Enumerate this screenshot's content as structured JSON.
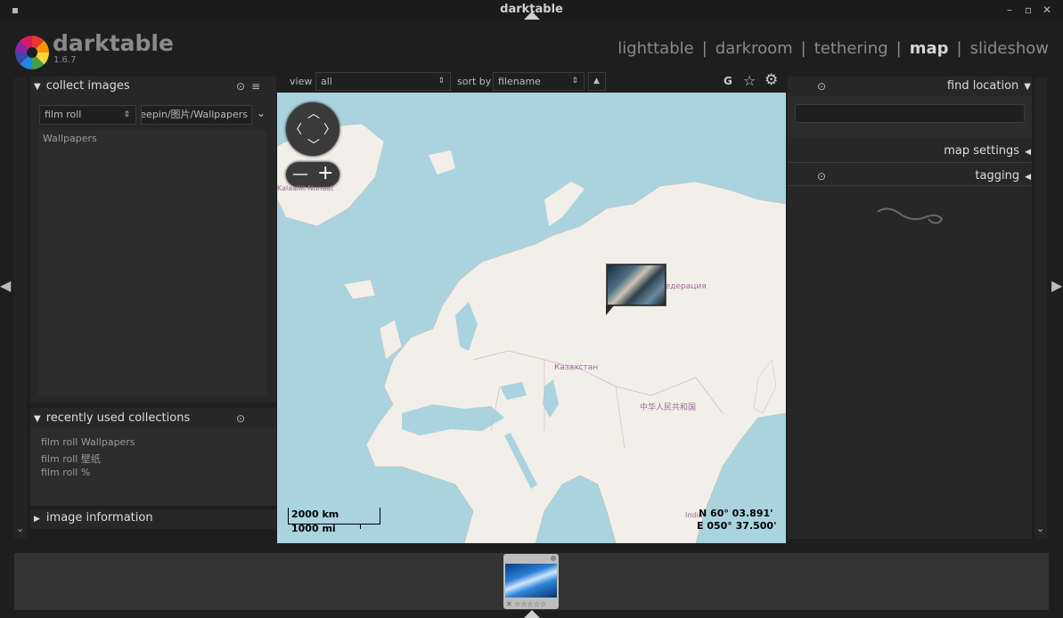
{
  "window": {
    "title": "darktable"
  },
  "header": {
    "app_name": "darktable",
    "version": "1.6.7",
    "views": [
      {
        "label": "lighttable",
        "active": false
      },
      {
        "label": "darkroom",
        "active": false
      },
      {
        "label": "tethering",
        "active": false
      },
      {
        "label": "map",
        "active": true
      },
      {
        "label": "slideshow",
        "active": false
      }
    ],
    "separator": "|"
  },
  "toolbar": {
    "view_label": "view",
    "view_value": "all",
    "sort_label": "sort by",
    "sort_value": "filename",
    "g_label": "G"
  },
  "left_panel": {
    "collect": {
      "title": "collect images",
      "property": "film roll",
      "path": "deepin/图片/Wallpapers",
      "items": [
        "Wallpapers"
      ]
    },
    "recent": {
      "title": "recently used collections",
      "items": [
        "film roll Wallpapers",
        "film roll 壁纸",
        "film roll %"
      ]
    },
    "info": {
      "title": "image information"
    }
  },
  "right_panel": {
    "find_location": {
      "title": "find location",
      "search_value": ""
    },
    "map_settings": {
      "title": "map settings"
    },
    "tagging": {
      "title": "tagging"
    }
  },
  "map": {
    "labels": {
      "kazakhstan": "Казахстан",
      "china": "中华人民共和国",
      "russia": "Федерация",
      "kalaallit": "Kalaallit Nunaat",
      "india": "India"
    },
    "scale_km": "2000 km",
    "scale_mi": "1000 mi",
    "coord_lat": "N 60° 03.891'",
    "coord_lon": "E 050° 37.500'"
  },
  "colors": {
    "background": "#1e1e1e",
    "panel": "#272727",
    "map_water": "#aad3df",
    "map_land": "#f2efe9",
    "active_view": "#d6d6d6",
    "inactive_view": "#8a8a8a"
  },
  "icons": [
    "close-icon",
    "minimize-icon",
    "maximize-icon",
    "triangle-down-icon",
    "reset-icon",
    "presets-icon",
    "star-icon",
    "gear-icon",
    "chevron-left-icon",
    "chevron-right-icon",
    "pan-arrows-icon",
    "zoom-out-icon",
    "zoom-in-icon"
  ]
}
